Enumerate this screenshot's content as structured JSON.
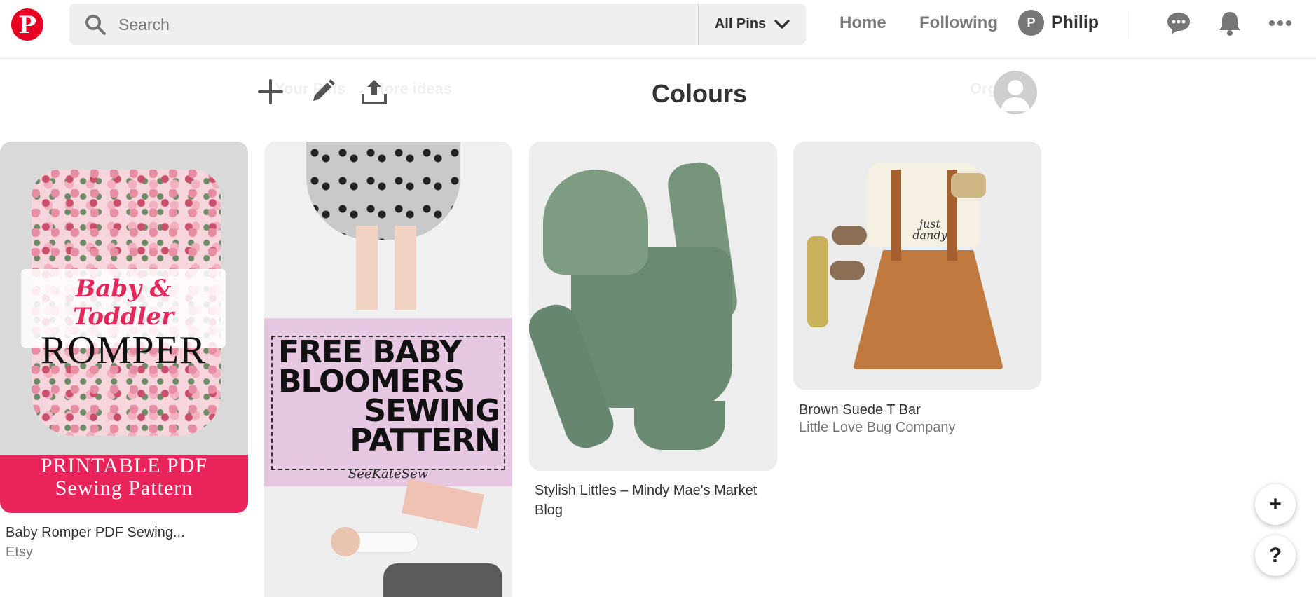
{
  "header": {
    "logo_letter": "P",
    "search_placeholder": "Search",
    "scope_label": "All Pins",
    "nav": {
      "home": "Home",
      "following": "Following"
    },
    "profile": {
      "initial": "P",
      "name": "Philip"
    },
    "icons": [
      "search-icon",
      "chevron-down-icon",
      "message-icon",
      "bell-icon",
      "more-icon"
    ]
  },
  "board": {
    "title": "Colours",
    "tools": [
      "add-icon",
      "edit-icon",
      "share-icon"
    ],
    "faded_tab_left": "Your Pins",
    "faded_tab_right": "More ideas",
    "faded_right": "Org"
  },
  "pins": [
    {
      "image_text": {
        "script": "Baby & Toddler",
        "main": "ROMPER",
        "band_1": "PRINTABLE PDF",
        "band_2": "Sewing Pattern"
      },
      "title": "Baby Romper PDF Sewing...",
      "source": "Etsy"
    },
    {
      "image_text": {
        "line_1": "FREE BABY",
        "line_2": "BLOOMERS",
        "line_3": "SEWING",
        "line_4": "PATTERN",
        "signature": "SeeKateSew"
      }
    },
    {
      "title": "Stylish Littles – Mindy Mae's Market Blog"
    },
    {
      "image_text": {
        "tee": "just dandy"
      },
      "title": "Brown Suede T Bar",
      "source": "Little Love Bug Company"
    }
  ],
  "floating": {
    "add": "+",
    "help": "?"
  },
  "colors": {
    "brand": "#e60023",
    "pink_band": "#e9245a",
    "lilac": "#e6c8e2"
  }
}
